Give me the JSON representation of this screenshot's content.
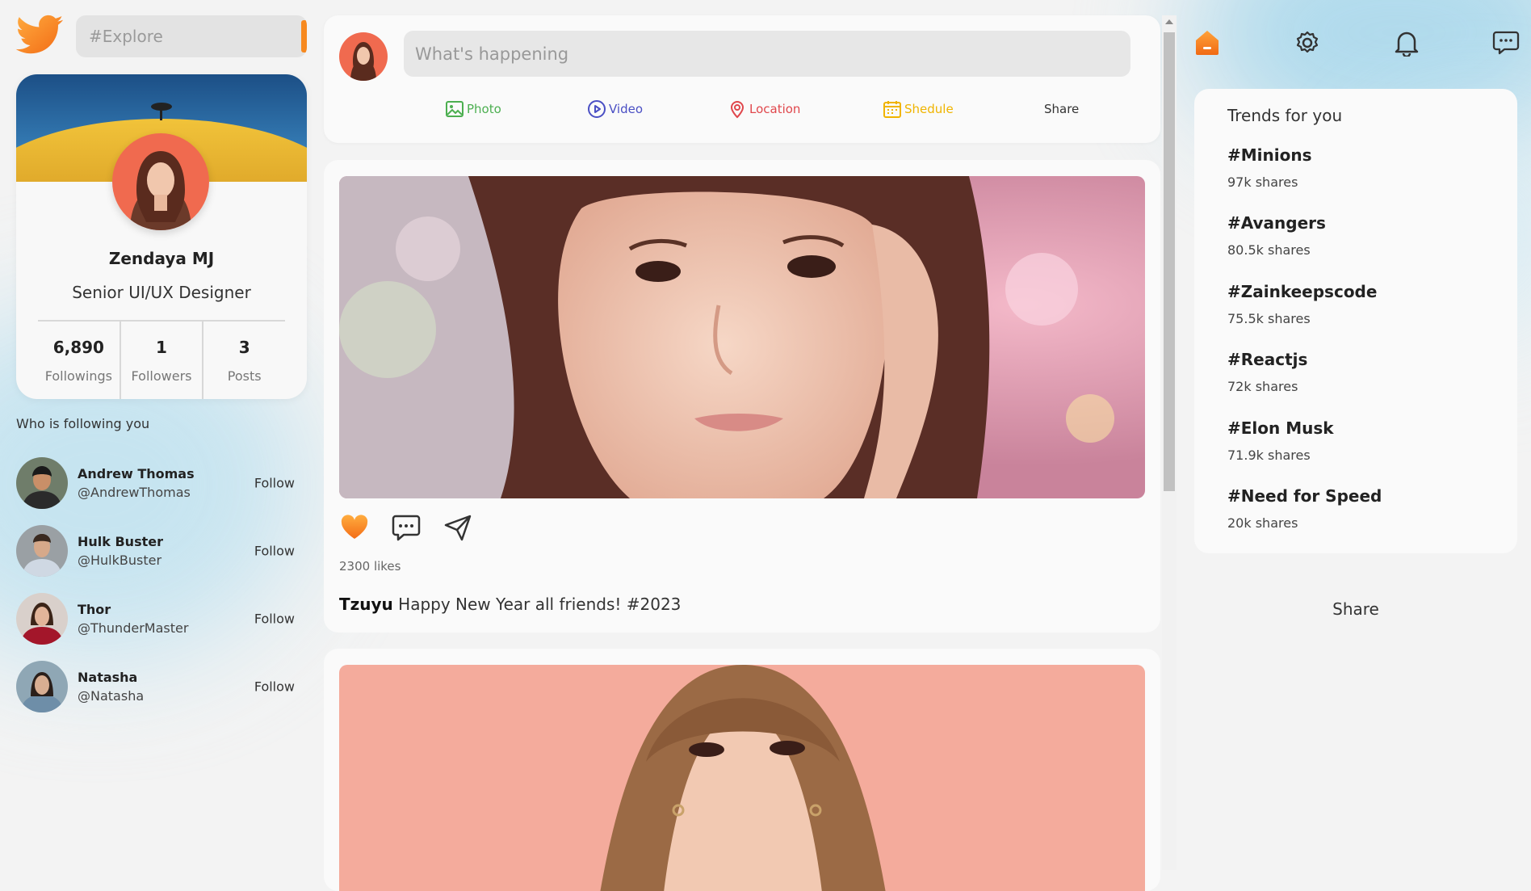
{
  "colors": {
    "accent": "#f7891f",
    "page_bg": "#f3f3f3",
    "card_bg": "#fafafa"
  },
  "search": {
    "placeholder": "#Explore"
  },
  "profile": {
    "name": "Zendaya MJ",
    "role": "Senior UI/UX Designer",
    "stats": [
      {
        "value": "6,890",
        "label": "Followings"
      },
      {
        "value": "1",
        "label": "Followers"
      },
      {
        "value": "3",
        "label": "Posts"
      }
    ]
  },
  "followers": {
    "heading": "Who is following you",
    "items": [
      {
        "name": "Andrew Thomas",
        "handle": "@AndrewThomas",
        "action": "Follow"
      },
      {
        "name": "Hulk Buster",
        "handle": "@HulkBuster",
        "action": "Follow"
      },
      {
        "name": "Thor",
        "handle": "@ThunderMaster",
        "action": "Follow"
      },
      {
        "name": "Natasha",
        "handle": "@Natasha",
        "action": "Follow"
      }
    ]
  },
  "compose": {
    "placeholder": "What's happening",
    "actions": [
      {
        "label": "Photo",
        "icon": "photo-icon",
        "color": "#4caf50"
      },
      {
        "label": "Video",
        "icon": "video-icon",
        "color": "#4a4fc4"
      },
      {
        "label": "Location",
        "icon": "location-icon",
        "color": "#e0474c"
      },
      {
        "label": "Shedule",
        "icon": "calendar-icon",
        "color": "#f0b400"
      },
      {
        "label": "Share",
        "icon": "",
        "color": "#333333"
      }
    ]
  },
  "post": {
    "likes": "2300 likes",
    "author": "Tzuyu",
    "text": "Happy New Year all friends! #2023",
    "actions": [
      "heart-icon",
      "comment-icon",
      "send-icon"
    ]
  },
  "top_icons": [
    "home-icon",
    "gear-icon",
    "bell-icon",
    "message-icon"
  ],
  "trends": {
    "title": "Trends for you",
    "items": [
      {
        "tag": "#Minions",
        "count": "97k shares"
      },
      {
        "tag": "#Avangers",
        "count": "80.5k shares"
      },
      {
        "tag": "#Zainkeepscode",
        "count": "75.5k shares"
      },
      {
        "tag": "#Reactjs",
        "count": "72k shares"
      },
      {
        "tag": "#Elon Musk",
        "count": "71.9k shares"
      },
      {
        "tag": "#Need for Speed",
        "count": "20k shares"
      }
    ]
  },
  "right_share": "Share"
}
